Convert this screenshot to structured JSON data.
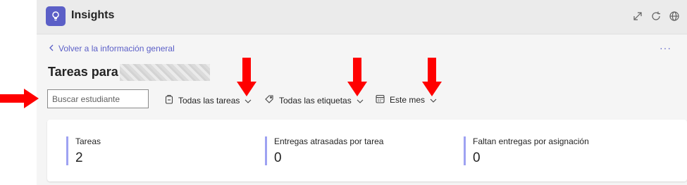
{
  "app": {
    "title": "Insights",
    "icon": "lightbulb-icon",
    "titlebar_icons": [
      "expand-icon",
      "refresh-icon",
      "globe-icon"
    ]
  },
  "nav": {
    "back_label": "Volver a la información general",
    "more_label": "···"
  },
  "page": {
    "title": "Tareas para"
  },
  "filters": {
    "search_placeholder": "Buscar estudiante",
    "tasks_label": "Todas las tareas",
    "tags_label": "Todas las etiquetas",
    "period_label": "Este mes"
  },
  "metrics": [
    {
      "label": "Tareas",
      "value": "2"
    },
    {
      "label": "Entregas atrasadas por tarea",
      "value": "0"
    },
    {
      "label": "Faltan entregas por asignación",
      "value": "0"
    }
  ],
  "colors": {
    "accent": "#5b5fc7",
    "metric_bar": "#9ea2f2",
    "annotation_arrow": "#ff0000"
  }
}
